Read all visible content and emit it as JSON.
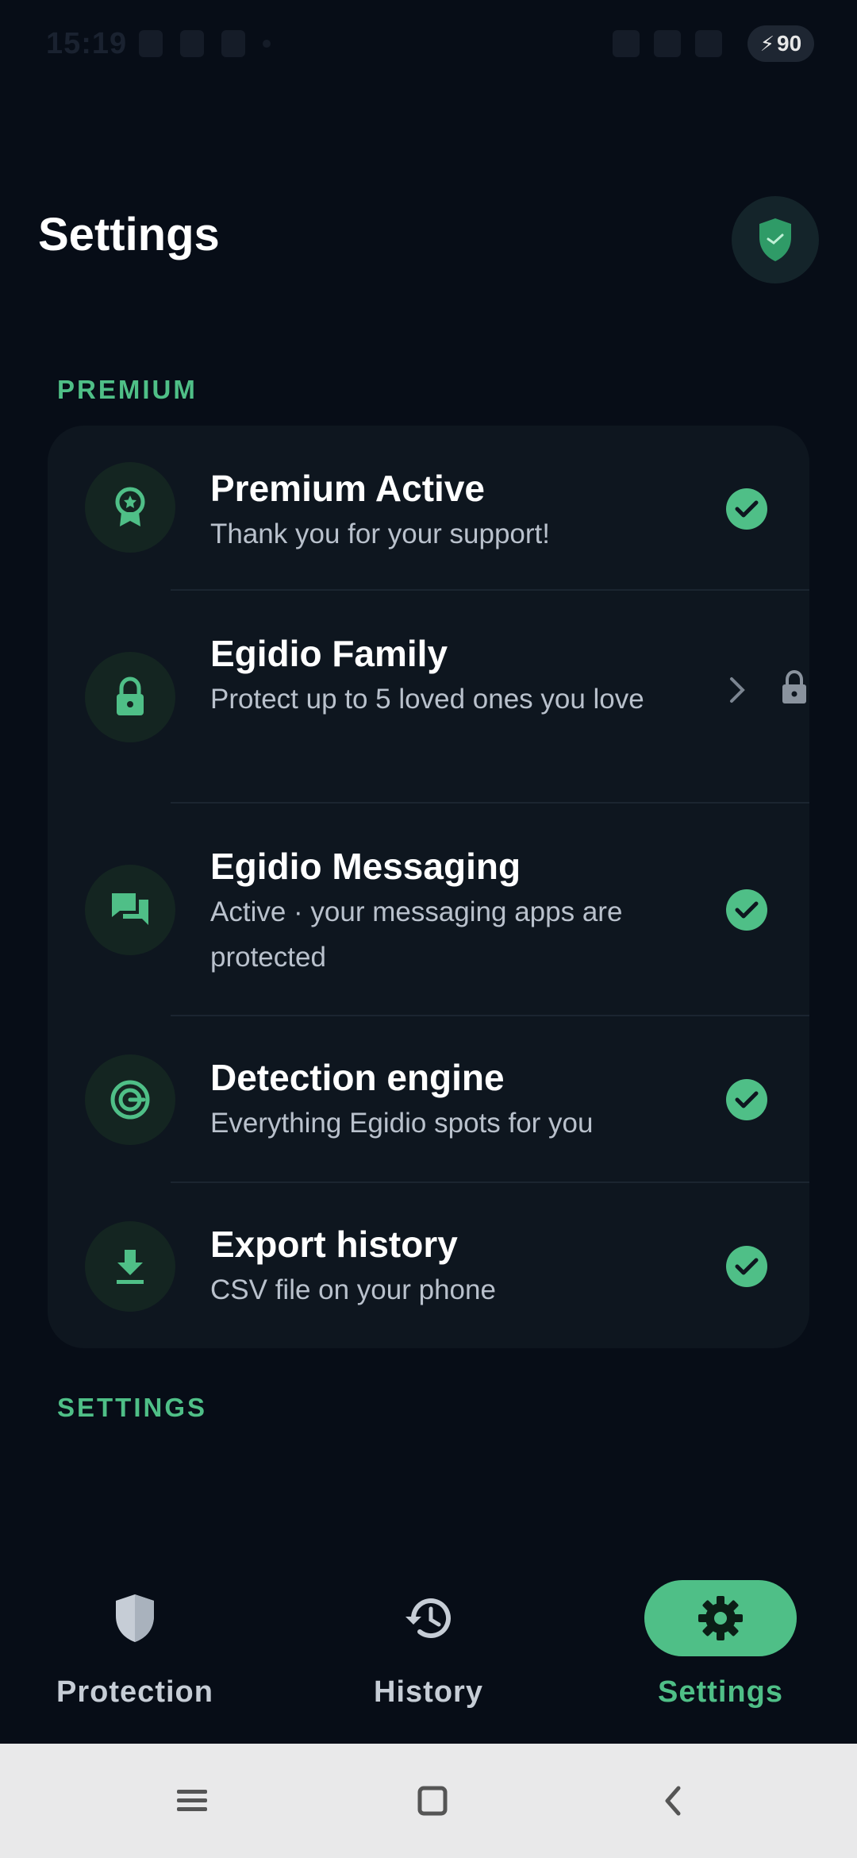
{
  "status_bar": {
    "time": "15:19",
    "battery_level": "90",
    "battery_icon": "battery-charging-icon"
  },
  "header": {
    "title": "Settings",
    "shield_icon": "shield-icon"
  },
  "sections": {
    "premium_label": "PREMIUM",
    "settings_label": "SETTINGS"
  },
  "premium_items": [
    {
      "title": "Premium Active",
      "subtitle": "Thank you for your support!",
      "icon": "award-badge-icon",
      "status": "check"
    },
    {
      "title": "Egidio Family",
      "subtitle": "Protect up to 5 loved ones you love",
      "icon": "lock-icon",
      "status": "locked"
    },
    {
      "title": "Egidio Messaging",
      "subtitle": "Active · your messaging apps are protected",
      "icon": "chat-bubbles-icon",
      "status": "check"
    },
    {
      "title": "Detection engine",
      "subtitle": "Everything Egidio spots for you",
      "icon": "target-icon",
      "status": "check"
    },
    {
      "title": "Export history",
      "subtitle": "CSV file on your phone",
      "icon": "download-icon",
      "status": "check"
    }
  ],
  "bottom_nav": [
    {
      "label": "Protection",
      "icon": "shield-icon",
      "active": false
    },
    {
      "label": "History",
      "icon": "history-icon",
      "active": false
    },
    {
      "label": "Settings",
      "icon": "gear-icon",
      "active": true
    }
  ],
  "system_nav": {
    "buttons": [
      "menu-icon",
      "home-icon",
      "back-icon"
    ]
  },
  "colors": {
    "background": "#070d17",
    "card": "#0e161f",
    "accent": "#4fbf87",
    "text_primary": "#ffffff",
    "text_secondary": "#b9c1cc"
  }
}
